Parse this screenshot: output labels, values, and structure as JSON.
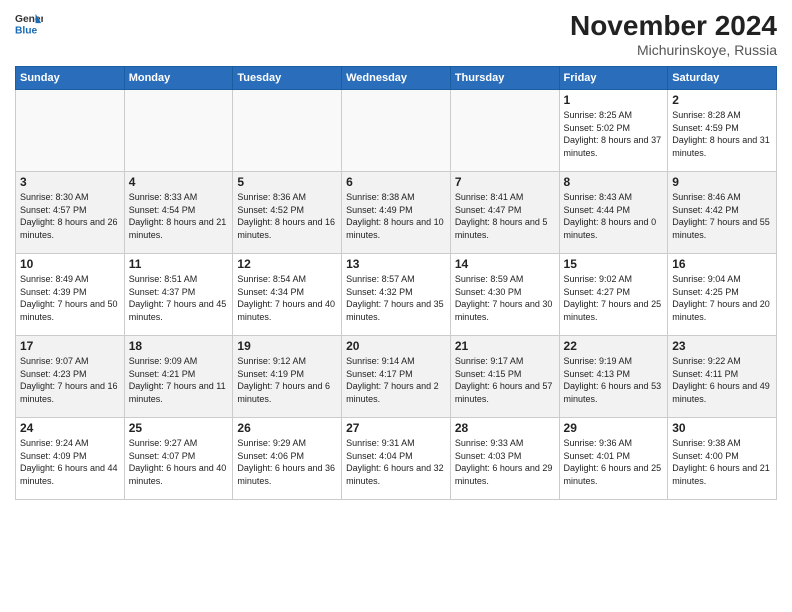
{
  "header": {
    "logo_general": "General",
    "logo_blue": "Blue",
    "month_title": "November 2024",
    "location": "Michurinskoye, Russia"
  },
  "days_of_week": [
    "Sunday",
    "Monday",
    "Tuesday",
    "Wednesday",
    "Thursday",
    "Friday",
    "Saturday"
  ],
  "weeks": [
    [
      {
        "day": "",
        "info": ""
      },
      {
        "day": "",
        "info": ""
      },
      {
        "day": "",
        "info": ""
      },
      {
        "day": "",
        "info": ""
      },
      {
        "day": "",
        "info": ""
      },
      {
        "day": "1",
        "info": "Sunrise: 8:25 AM\nSunset: 5:02 PM\nDaylight: 8 hours and 37 minutes."
      },
      {
        "day": "2",
        "info": "Sunrise: 8:28 AM\nSunset: 4:59 PM\nDaylight: 8 hours and 31 minutes."
      }
    ],
    [
      {
        "day": "3",
        "info": "Sunrise: 8:30 AM\nSunset: 4:57 PM\nDaylight: 8 hours and 26 minutes."
      },
      {
        "day": "4",
        "info": "Sunrise: 8:33 AM\nSunset: 4:54 PM\nDaylight: 8 hours and 21 minutes."
      },
      {
        "day": "5",
        "info": "Sunrise: 8:36 AM\nSunset: 4:52 PM\nDaylight: 8 hours and 16 minutes."
      },
      {
        "day": "6",
        "info": "Sunrise: 8:38 AM\nSunset: 4:49 PM\nDaylight: 8 hours and 10 minutes."
      },
      {
        "day": "7",
        "info": "Sunrise: 8:41 AM\nSunset: 4:47 PM\nDaylight: 8 hours and 5 minutes."
      },
      {
        "day": "8",
        "info": "Sunrise: 8:43 AM\nSunset: 4:44 PM\nDaylight: 8 hours and 0 minutes."
      },
      {
        "day": "9",
        "info": "Sunrise: 8:46 AM\nSunset: 4:42 PM\nDaylight: 7 hours and 55 minutes."
      }
    ],
    [
      {
        "day": "10",
        "info": "Sunrise: 8:49 AM\nSunset: 4:39 PM\nDaylight: 7 hours and 50 minutes."
      },
      {
        "day": "11",
        "info": "Sunrise: 8:51 AM\nSunset: 4:37 PM\nDaylight: 7 hours and 45 minutes."
      },
      {
        "day": "12",
        "info": "Sunrise: 8:54 AM\nSunset: 4:34 PM\nDaylight: 7 hours and 40 minutes."
      },
      {
        "day": "13",
        "info": "Sunrise: 8:57 AM\nSunset: 4:32 PM\nDaylight: 7 hours and 35 minutes."
      },
      {
        "day": "14",
        "info": "Sunrise: 8:59 AM\nSunset: 4:30 PM\nDaylight: 7 hours and 30 minutes."
      },
      {
        "day": "15",
        "info": "Sunrise: 9:02 AM\nSunset: 4:27 PM\nDaylight: 7 hours and 25 minutes."
      },
      {
        "day": "16",
        "info": "Sunrise: 9:04 AM\nSunset: 4:25 PM\nDaylight: 7 hours and 20 minutes."
      }
    ],
    [
      {
        "day": "17",
        "info": "Sunrise: 9:07 AM\nSunset: 4:23 PM\nDaylight: 7 hours and 16 minutes."
      },
      {
        "day": "18",
        "info": "Sunrise: 9:09 AM\nSunset: 4:21 PM\nDaylight: 7 hours and 11 minutes."
      },
      {
        "day": "19",
        "info": "Sunrise: 9:12 AM\nSunset: 4:19 PM\nDaylight: 7 hours and 6 minutes."
      },
      {
        "day": "20",
        "info": "Sunrise: 9:14 AM\nSunset: 4:17 PM\nDaylight: 7 hours and 2 minutes."
      },
      {
        "day": "21",
        "info": "Sunrise: 9:17 AM\nSunset: 4:15 PM\nDaylight: 6 hours and 57 minutes."
      },
      {
        "day": "22",
        "info": "Sunrise: 9:19 AM\nSunset: 4:13 PM\nDaylight: 6 hours and 53 minutes."
      },
      {
        "day": "23",
        "info": "Sunrise: 9:22 AM\nSunset: 4:11 PM\nDaylight: 6 hours and 49 minutes."
      }
    ],
    [
      {
        "day": "24",
        "info": "Sunrise: 9:24 AM\nSunset: 4:09 PM\nDaylight: 6 hours and 44 minutes."
      },
      {
        "day": "25",
        "info": "Sunrise: 9:27 AM\nSunset: 4:07 PM\nDaylight: 6 hours and 40 minutes."
      },
      {
        "day": "26",
        "info": "Sunrise: 9:29 AM\nSunset: 4:06 PM\nDaylight: 6 hours and 36 minutes."
      },
      {
        "day": "27",
        "info": "Sunrise: 9:31 AM\nSunset: 4:04 PM\nDaylight: 6 hours and 32 minutes."
      },
      {
        "day": "28",
        "info": "Sunrise: 9:33 AM\nSunset: 4:03 PM\nDaylight: 6 hours and 29 minutes."
      },
      {
        "day": "29",
        "info": "Sunrise: 9:36 AM\nSunset: 4:01 PM\nDaylight: 6 hours and 25 minutes."
      },
      {
        "day": "30",
        "info": "Sunrise: 9:38 AM\nSunset: 4:00 PM\nDaylight: 6 hours and 21 minutes."
      }
    ]
  ]
}
